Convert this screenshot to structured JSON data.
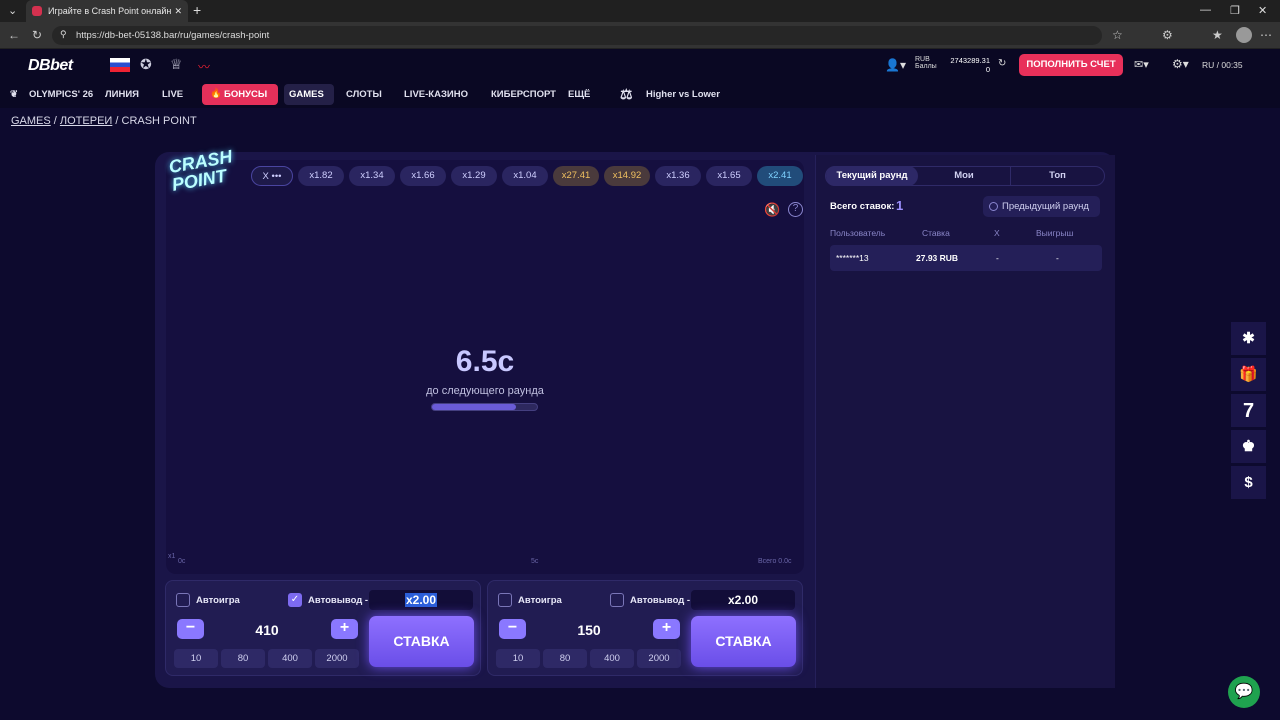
{
  "browser": {
    "tab_title": "Играйте в Crash Point онлайн 👉",
    "url": "https://db-bet-05138.bar/ru/games/crash-point"
  },
  "header": {
    "logo_db": "DB",
    "logo_bet": "bet",
    "currency": "RUB",
    "balance": "2743289.31",
    "points_label": "Баллы",
    "points": "0",
    "topup_label": "ПОПОЛНИТЬ СЧЕТ",
    "locale": "RU / 00:35"
  },
  "nav": {
    "olympics": "OLYMPICS' 26",
    "line": "ЛИНИЯ",
    "live": "LIVE",
    "bonuses": "БОНУСЫ",
    "games": "GAMES",
    "slots": "СЛОТЫ",
    "live_casino": "LIVE-КАЗИНО",
    "esports": "КИБЕРСПОРТ",
    "more": "ЕЩЁ",
    "higher_lower": "Higher vs Lower"
  },
  "breadcrumb": {
    "games": "GAMES",
    "lotteries": "ЛОТЕРЕИ",
    "current": "CRASH POINT"
  },
  "game": {
    "logo_line1": "CRASH",
    "logo_line2": "POINT",
    "history_toggle": "X •••",
    "history": [
      "x1.82",
      "x1.34",
      "x1.66",
      "x1.29",
      "x1.04",
      "x27.41",
      "x14.92",
      "x1.36",
      "x1.65",
      "x2.41"
    ],
    "countdown": "6.5с",
    "countdown_label": "до следующего раунда",
    "countdown_progress": 0.8,
    "axis_y": "x1",
    "axis_x0": "0с",
    "axis_x1": "5с",
    "total_label": "Всего 0.0с"
  },
  "bets": [
    {
      "autoplay_label": "Автоигра",
      "autoplay": false,
      "cashout_label": "Автовывод -",
      "cashout": true,
      "multiplier": "x2.00",
      "amount": "410",
      "quick": [
        "10",
        "80",
        "400",
        "2000"
      ],
      "stake_label": "СТАВКА"
    },
    {
      "autoplay_label": "Автоигра",
      "autoplay": false,
      "cashout_label": "Автовывод -",
      "cashout": false,
      "multiplier": "x2.00",
      "amount": "150",
      "quick": [
        "10",
        "80",
        "400",
        "2000"
      ],
      "stake_label": "СТАВКА"
    }
  ],
  "side": {
    "tabs": [
      "Текущий раунд",
      "Мои",
      "Топ"
    ],
    "total_bets_label": "Всего ставок:",
    "total_bets": "1",
    "prev_round": "Предыдущий раунд",
    "columns": [
      "Пользователь",
      "Ставка",
      "X",
      "Выигрыш"
    ],
    "rows": [
      {
        "user": "*******13",
        "bet": "27.93 RUB",
        "x": "-",
        "win": "-"
      }
    ]
  },
  "rail": {
    "seven": "7"
  },
  "colors": {
    "accent": "#7d6bf0",
    "brand": "#e8305a",
    "bg": "#0d0a2e"
  }
}
